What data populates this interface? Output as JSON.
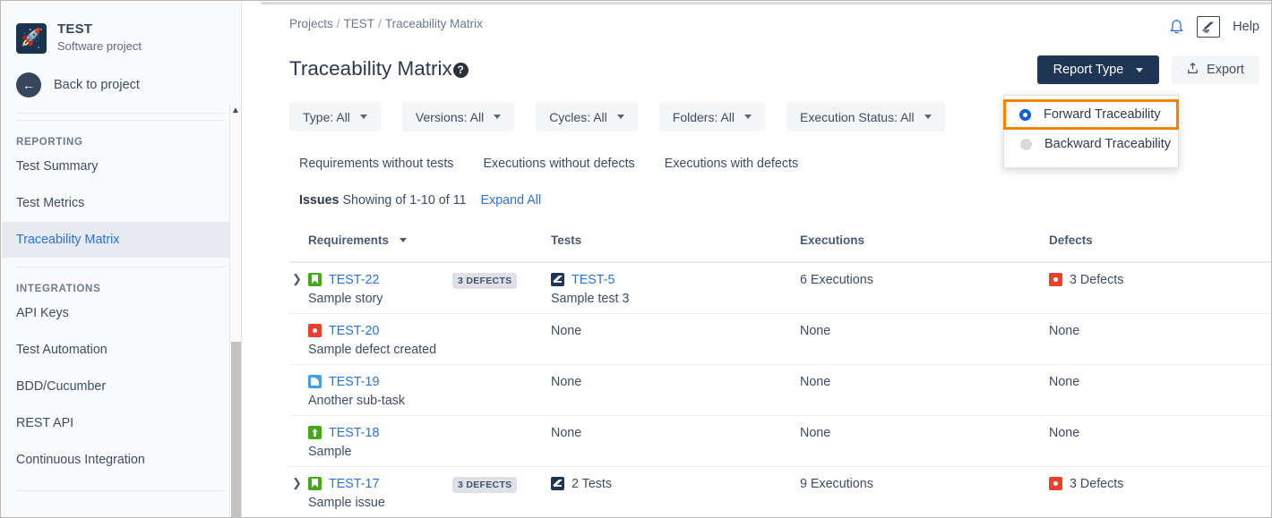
{
  "sidebar": {
    "project": {
      "name": "TEST",
      "subtitle": "Software project",
      "avatar_icon": "rocket-icon"
    },
    "back": {
      "label": "Back to project",
      "icon": "arrow-left-icon"
    },
    "sections": [
      {
        "title": "REPORTING",
        "items": [
          {
            "label": "Test Summary",
            "active": false
          },
          {
            "label": "Test Metrics",
            "active": false
          },
          {
            "label": "Traceability Matrix",
            "active": true
          }
        ]
      },
      {
        "title": "INTEGRATIONS",
        "items": [
          {
            "label": "API Keys",
            "active": false
          },
          {
            "label": "Test Automation",
            "active": false
          },
          {
            "label": "BDD/Cucumber",
            "active": false
          },
          {
            "label": "REST API",
            "active": false
          },
          {
            "label": "Continuous Integration",
            "active": false
          }
        ]
      }
    ],
    "scrollbar": {
      "up_arrow_icon": "chevron-up-icon"
    }
  },
  "header": {
    "breadcrumb": [
      "Projects",
      "TEST",
      "Traceability Matrix"
    ],
    "breadcrumb_separator": "/",
    "title": "Traceability Matrix",
    "help_badge_icon": "question-mark-icon",
    "notifications_icon": "bell-icon",
    "zephyr_icon": "zephyr-logo-icon",
    "help_label": "Help"
  },
  "actions": {
    "report_type_label": "Report Type",
    "report_type_caret_icon": "chevron-down-icon",
    "export_label": "Export",
    "export_icon": "upload-icon"
  },
  "report_menu": {
    "options": [
      {
        "label": "Forward Traceability",
        "selected": true,
        "highlighted": true
      },
      {
        "label": "Backward Traceability",
        "selected": false,
        "highlighted": false
      }
    ],
    "highlight_color": "#f58200",
    "selected_color": "#1061d8"
  },
  "filters": [
    {
      "label": "Type: All"
    },
    {
      "label": "Versions: All"
    },
    {
      "label": "Cycles: All"
    },
    {
      "label": "Folders: All"
    },
    {
      "label": "Execution Status: All"
    }
  ],
  "quicklinks": [
    {
      "label": "Requirements without tests"
    },
    {
      "label": "Executions without defects"
    },
    {
      "label": "Executions with defects"
    }
  ],
  "issues_bar": {
    "label": "Issues",
    "showing": "Showing of 1-10 of 11",
    "expand_all": "Expand All"
  },
  "table": {
    "columns": [
      {
        "label": "Requirements",
        "sortable": true,
        "sort_icon": "chevron-down-icon"
      },
      {
        "label": "Tests",
        "sortable": false
      },
      {
        "label": "Executions",
        "sortable": false
      },
      {
        "label": "Defects",
        "sortable": false
      }
    ],
    "rows": [
      {
        "expandable": true,
        "req_icon": "story-icon",
        "req_key": "TEST-22",
        "req_summary": "Sample story",
        "badge": "3 DEFECTS",
        "test_icon": "test-icon",
        "test_key": "TEST-5",
        "test_summary": "Sample test 3",
        "executions": "6 Executions",
        "defects_icon": "bug-icon",
        "defects": "3 Defects"
      },
      {
        "expandable": false,
        "req_icon": "bug-icon",
        "req_key": "TEST-20",
        "req_summary": "Sample defect created",
        "badge": "",
        "test_icon": "",
        "test_key": "None",
        "test_summary": "",
        "executions": "None",
        "defects_icon": "",
        "defects": "None"
      },
      {
        "expandable": false,
        "req_icon": "subtask-icon",
        "req_key": "TEST-19",
        "req_summary": "Another sub-task",
        "badge": "",
        "test_icon": "",
        "test_key": "None",
        "test_summary": "",
        "executions": "None",
        "defects_icon": "",
        "defects": "None"
      },
      {
        "expandable": false,
        "req_icon": "improvement-icon",
        "req_key": "TEST-18",
        "req_summary": "Sample",
        "badge": "",
        "test_icon": "",
        "test_key": "None",
        "test_summary": "",
        "executions": "None",
        "defects_icon": "",
        "defects": "None"
      },
      {
        "expandable": true,
        "req_icon": "story-icon",
        "req_key": "TEST-17",
        "req_summary": "Sample issue",
        "badge": "3 DEFECTS",
        "test_icon": "test-icon",
        "test_key": "2 Tests",
        "test_summary": "",
        "executions": "9 Executions",
        "defects_icon": "bug-icon",
        "defects": "3 Defects"
      }
    ]
  }
}
